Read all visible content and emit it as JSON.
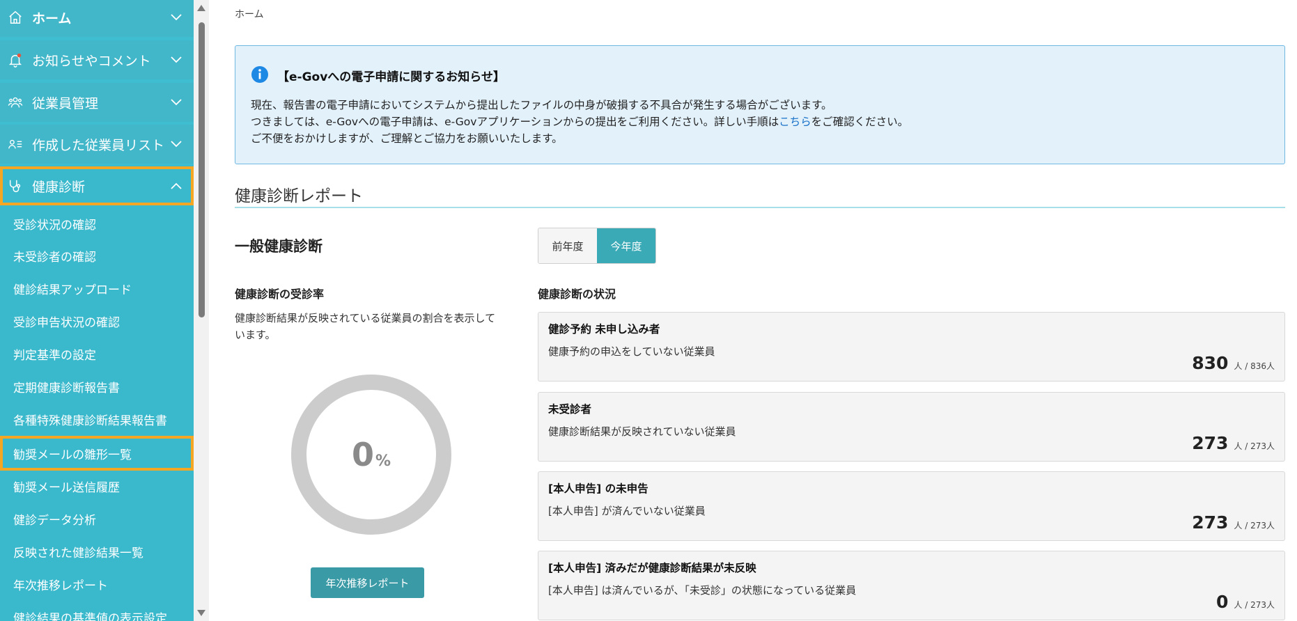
{
  "sidebar": {
    "nav": [
      {
        "label": "ホーム",
        "icon": "home-icon"
      },
      {
        "label": "お知らせやコメント",
        "icon": "bell-icon"
      },
      {
        "label": "従業員管理",
        "icon": "people-icon"
      },
      {
        "label": "作成した従業員リスト",
        "icon": "user-list-icon"
      },
      {
        "label": "健康診断",
        "icon": "stethoscope-icon"
      }
    ],
    "sub_items": [
      "受診状況の確認",
      "未受診者の確認",
      "健診結果アップロード",
      "受診申告状況の確認",
      "判定基準の設定",
      "定期健康診断報告書",
      "各種特殊健康診断結果報告書",
      "勧奨メールの雛形一覧",
      "勧奨メール送信履歴",
      "健診データ分析",
      "反映された健診結果一覧",
      "年次推移レポート",
      "健診結果の基準値の表示設定"
    ]
  },
  "breadcrumb": "ホーム",
  "notice": {
    "title": "【e-Govへの電子申請に関するお知らせ】",
    "line1": "現在、報告書の電子申請においてシステムから提出したファイルの中身が破損する不具合が発生する場合がございます。",
    "line2_pre": "つきましては、e-Govへの電子申請は、e-Govアプリケーションからの提出をご利用ください。詳しい手順は",
    "line2_link": "こちら",
    "line2_post": "をご確認ください。",
    "line3": "ご不便をおかけしますが、ご理解とご協力をお願いいたします。"
  },
  "report": {
    "section_title": "健康診断レポート",
    "sub_title": "一般健康診断",
    "year_prev": "前年度",
    "year_current": "今年度",
    "rate_title": "健康診断の受診率",
    "rate_desc": "健康診断結果が反映されている従業員の割合を表示しています。",
    "rate_value": "0",
    "rate_unit": "%",
    "rate_fraction": 0,
    "trend_button": "年次推移レポート",
    "status_title": "健康診断の状況"
  },
  "cards": [
    {
      "title": "健診予約 未申し込み者",
      "desc": "健康予約の申込をしていない従業員",
      "value": "830",
      "unit": "人 / 836人"
    },
    {
      "title": "未受診者",
      "desc": "健康診断結果が反映されていない従業員",
      "value": "273",
      "unit": "人 / 273人"
    },
    {
      "title": "[本人申告] の未申告",
      "desc": "[本人申告] が済んでいない従業員",
      "value": "273",
      "unit": "人 / 273人"
    },
    {
      "title": "[本人申告] 済みだが健康診断結果が未反映",
      "desc": "[本人申告] は済んでいるが、「未受診」の状態になっている従業員",
      "value": "0",
      "unit": "人 / 273人"
    }
  ],
  "colors": {
    "sidebar": "#3ab8cc",
    "highlight": "#f5a623",
    "accent_button": "#3a9aa6",
    "notice_bg": "#e3f1fb",
    "donut_track": "#cccccc"
  }
}
